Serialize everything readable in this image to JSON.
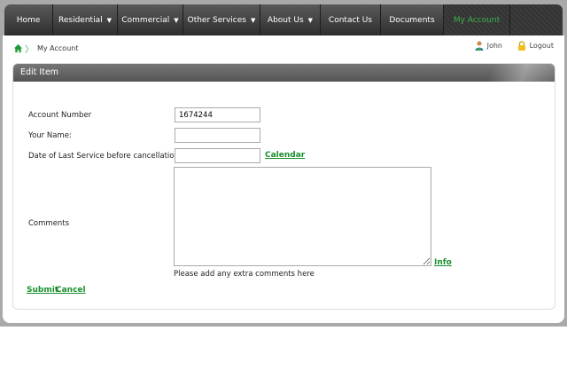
{
  "nav": {
    "items": [
      {
        "label": "Home"
      },
      {
        "label": "Residential",
        "dropdown": true
      },
      {
        "label": "Commercial",
        "dropdown": true
      },
      {
        "label": "Other Services",
        "dropdown": true
      },
      {
        "label": "About Us",
        "dropdown": true
      },
      {
        "label": "Contact Us"
      },
      {
        "label": "Documents"
      },
      {
        "label": "My Account",
        "active": true
      }
    ],
    "dropdown_glyph": "▼",
    "active_color": "#3bb34a"
  },
  "breadcrumb": {
    "home_icon": "home-icon",
    "separator": "〉",
    "current": "My Account"
  },
  "user": {
    "name": "John",
    "icon": "user-icon"
  },
  "logout": {
    "label": "Logout",
    "icon": "lock-icon"
  },
  "panel": {
    "title": "Edit Item"
  },
  "form": {
    "account_number": {
      "label": "Account Number",
      "value": "1674244"
    },
    "your_name": {
      "label": "Your Name:",
      "value": ""
    },
    "last_service_date": {
      "label": "Date of Last Service before cancellation",
      "value": "",
      "calendar_link": "Calendar"
    },
    "comments": {
      "label": "Comments",
      "value": "",
      "info_link": "Info",
      "hint": "Please add any extra comments here"
    },
    "submit_label": "Submit",
    "cancel_label": "Cancel"
  },
  "colors": {
    "link": "#1a8f2e",
    "nav_bg": "#3a3a3a",
    "panel_header": "#5e5e5e"
  }
}
